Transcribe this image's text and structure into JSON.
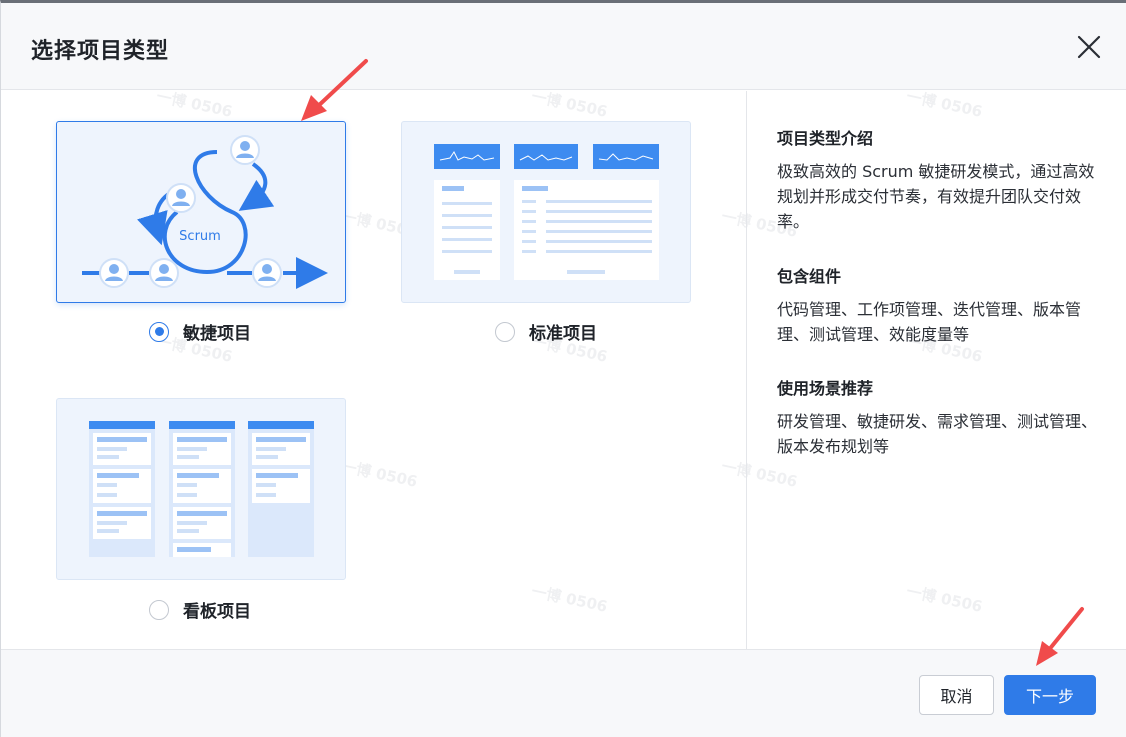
{
  "dialog": {
    "title": "选择项目类型",
    "close_icon": "close-icon"
  },
  "options": [
    {
      "label": "敏捷项目",
      "selected": true,
      "illustration_text": "Scrum"
    },
    {
      "label": "标准项目",
      "selected": false
    },
    {
      "label": "看板项目",
      "selected": false
    }
  ],
  "info": {
    "sections": [
      {
        "heading": "项目类型介绍",
        "body": "极致高效的 Scrum 敏捷研发模式，通过高效规划并形成交付节奏，有效提升团队交付效率。"
      },
      {
        "heading": "包含组件",
        "body": "代码管理、工作项管理、迭代管理、版本管理、测试管理、效能度量等"
      },
      {
        "heading": "使用场景推荐",
        "body": "研发管理、敏捷研发、需求管理、测试管理、版本发布规划等"
      }
    ]
  },
  "footer": {
    "cancel_label": "取消",
    "next_label": "下一步"
  },
  "colors": {
    "accent": "#2f7be8",
    "annotation_arrow": "#f04b4b",
    "card_bg": "#eef4fd"
  },
  "watermark": "一博 0506"
}
